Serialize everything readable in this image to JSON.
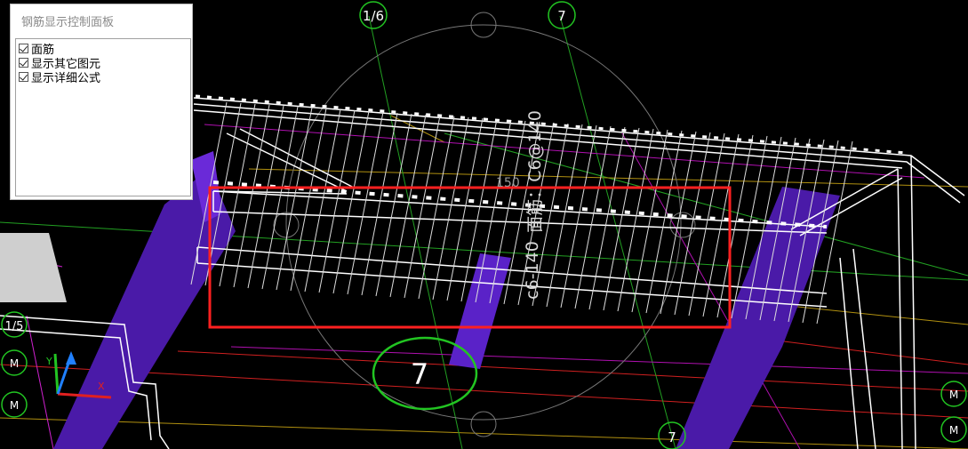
{
  "panel": {
    "title": "钢筋显示控制面板",
    "options": [
      {
        "label": "面筋",
        "checked": true
      },
      {
        "label": "显示其它图元",
        "checked": true
      },
      {
        "label": "显示详细公式",
        "checked": true
      }
    ]
  },
  "drawing": {
    "rebar_label_top": "面筋：C6@140",
    "rebar_label_lower": "c6-140",
    "dimension_150": "150",
    "axis_top_left": "1/6",
    "axis_top_right": "7",
    "axis_center": "7",
    "axis_bottom": "7",
    "axis_left": "1/5",
    "axis_m1": "M",
    "axis_m2": "M",
    "axis_m3": "M",
    "axis_m4": "M",
    "ucs_x": "X",
    "ucs_y": "Y"
  },
  "colors": {
    "background": "#000000",
    "highlight_box": "#ff2020",
    "column_purple": "#5a22c8",
    "axis_green": "#22c522",
    "rebar_white": "#ffffff"
  }
}
